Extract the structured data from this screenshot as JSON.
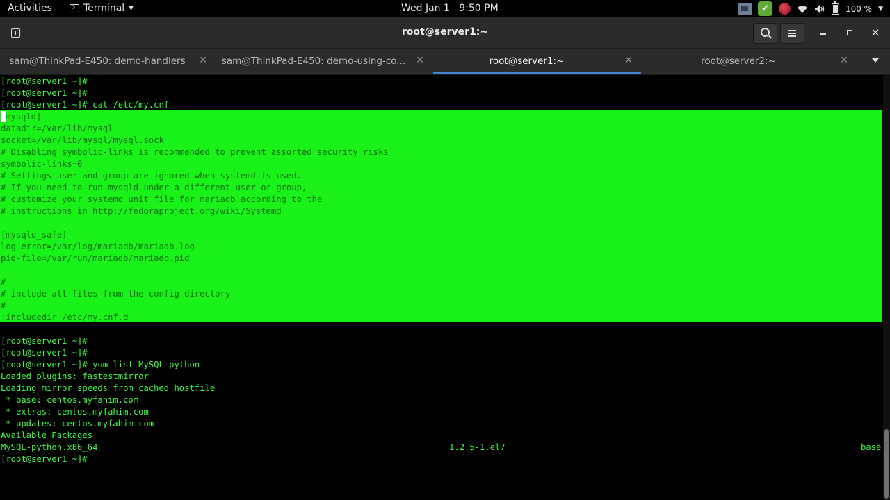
{
  "topbar": {
    "activities": "Activities",
    "app_name": "Terminal",
    "clock": "Wed Jan 1   9:50 PM",
    "battery": "100 %",
    "icons": [
      "app-tray-icon",
      "checkmark-tray-icon",
      "record-tray-icon",
      "wifi-icon",
      "volume-icon",
      "battery-icon",
      "chevron-down-icon"
    ]
  },
  "window": {
    "title": "root@server1:~"
  },
  "tabs": [
    {
      "label": "sam@ThinkPad-E450: demo-handlers",
      "active": false
    },
    {
      "label": "sam@ThinkPad-E450: demo-using-co...",
      "active": false
    },
    {
      "label": "root@server1:~",
      "active": true
    },
    {
      "label": "root@server2:~",
      "active": false
    }
  ],
  "terminal": {
    "lines": [
      "[root@server1 ~]#",
      "[root@server1 ~]#",
      "[root@server1 ~]# cat /etc/my.cnf",
      "mysqld]",
      "datadir=/var/lib/mysql",
      "socket=/var/lib/mysql/mysql.sock",
      "# Disabling symbolic-links is recommended to prevent assorted security risks",
      "symbolic-links=0",
      "# Settings user and group are ignored when systemd is used.",
      "# If you need to run mysqld under a different user or group,",
      "# customize your systemd unit file for mariadb according to the",
      "# instructions in http://fedoraproject.org/wiki/Systemd",
      "",
      "[mysqld_safe]",
      "log-error=/var/log/mariadb/mariadb.log",
      "pid-file=/var/run/mariadb/mariadb.pid",
      "",
      "#",
      "# include all files from the config directory",
      "#",
      "!includedir /etc/my.cnf.d",
      "",
      "[root@server1 ~]#",
      "[root@server1 ~]#",
      "[root@server1 ~]# yum list MySQL-python",
      "Loaded plugins: fastestmirror",
      "Loading mirror speeds from cached hostfile",
      " * base: centos.myfahim.com",
      " * extras: centos.myfahim.com",
      " * updates: centos.myfahim.com",
      "Available Packages",
      "MySQL-python.x86_64",
      "[root@server1 ~]#"
    ],
    "package_version": "1.2.5-1.el7",
    "package_repo": "base"
  },
  "colors": {
    "terminal_fg": "#3df73d",
    "selection_bg": "#19f219",
    "tab_indicator": "#3f84d6"
  }
}
